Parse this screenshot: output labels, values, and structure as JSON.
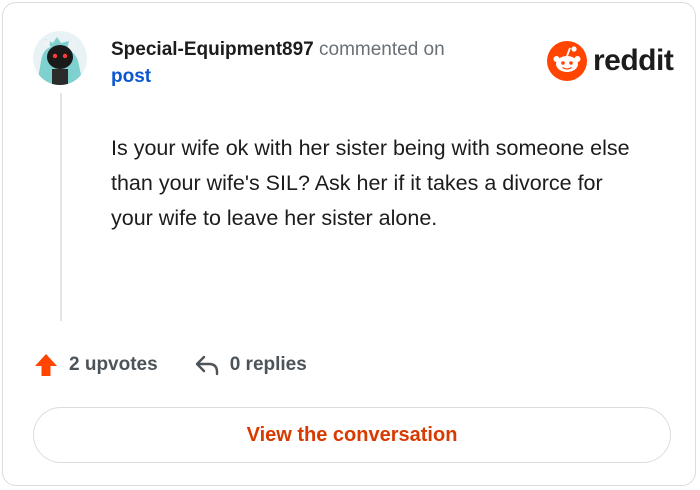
{
  "comment": {
    "author": "Special-Equipment897",
    "action_text": "commented on",
    "post_link": "post",
    "body": "Is your wife ok with her sister being with someone else than your wife's SIL? Ask her if it takes a divorce for your wife to leave her sister alone."
  },
  "brand": {
    "name": "reddit",
    "icon": "reddit-logo-icon",
    "color": "#ff4500"
  },
  "footer": {
    "upvotes": "2 upvotes",
    "replies": "0 replies",
    "upvote_icon": "upvote-arrow-icon",
    "reply_icon": "reply-arrow-icon",
    "accent": "#ff4500"
  },
  "cta": {
    "label": "View the conversation",
    "color": "#d93a00"
  }
}
